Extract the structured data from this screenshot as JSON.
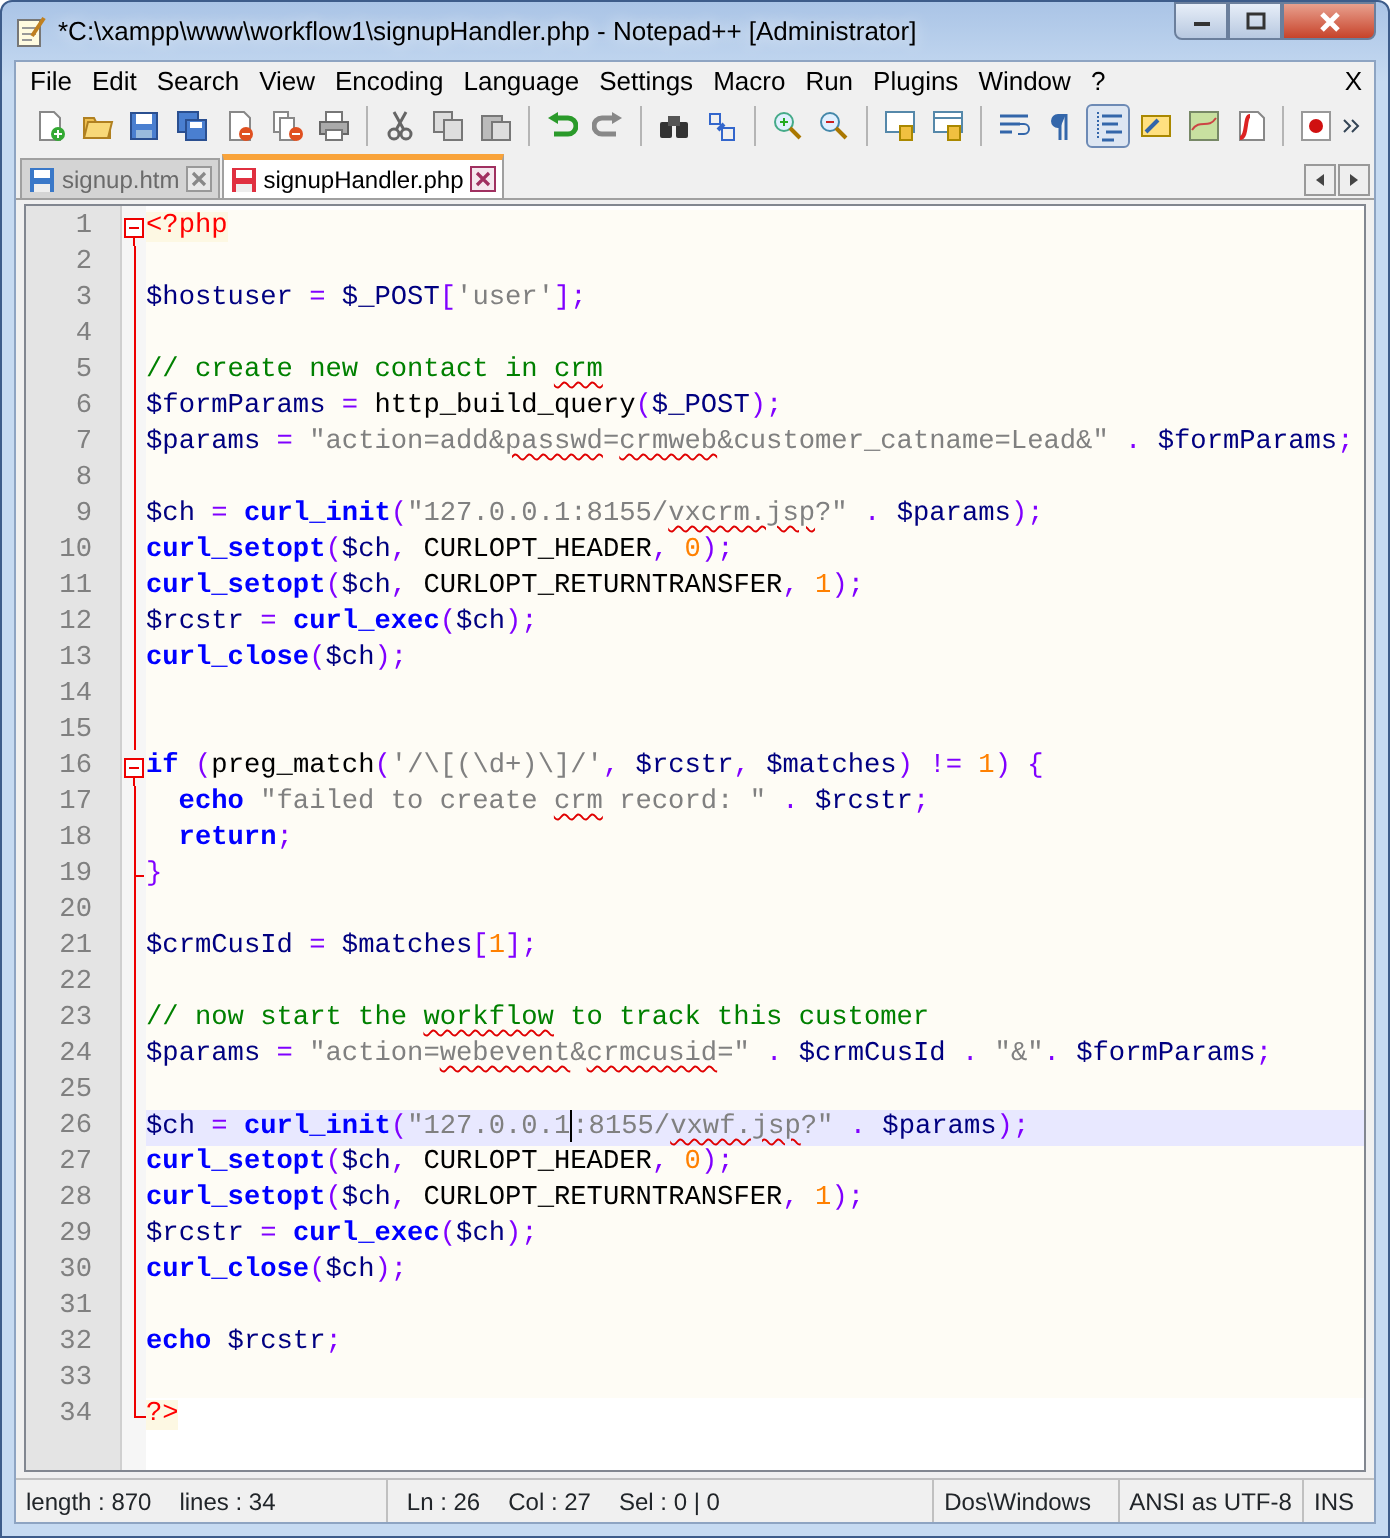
{
  "window": {
    "title": "*C:\\xampp\\www\\workflow1\\signupHandler.php - Notepad++ [Administrator]"
  },
  "menu": [
    "File",
    "Edit",
    "Search",
    "View",
    "Encoding",
    "Language",
    "Settings",
    "Macro",
    "Run",
    "Plugins",
    "Window",
    "?"
  ],
  "menu_close": "X",
  "toolbar": [
    {
      "kind": "new",
      "pressed": false
    },
    {
      "kind": "open",
      "pressed": false
    },
    {
      "kind": "save",
      "pressed": false
    },
    {
      "kind": "saveall",
      "pressed": false
    },
    {
      "kind": "close",
      "pressed": false
    },
    {
      "kind": "closeall",
      "pressed": false
    },
    {
      "kind": "print",
      "pressed": false
    },
    {
      "kind": "sep"
    },
    {
      "kind": "cut",
      "pressed": false
    },
    {
      "kind": "copy",
      "pressed": false
    },
    {
      "kind": "paste",
      "pressed": false
    },
    {
      "kind": "sep"
    },
    {
      "kind": "undo",
      "pressed": false
    },
    {
      "kind": "redo",
      "pressed": false
    },
    {
      "kind": "sep"
    },
    {
      "kind": "find",
      "pressed": false
    },
    {
      "kind": "replace",
      "pressed": false
    },
    {
      "kind": "sep"
    },
    {
      "kind": "zoomin",
      "pressed": false
    },
    {
      "kind": "zoomout",
      "pressed": false
    },
    {
      "kind": "sep"
    },
    {
      "kind": "syncv",
      "pressed": false
    },
    {
      "kind": "synch",
      "pressed": false
    },
    {
      "kind": "sep"
    },
    {
      "kind": "wrap",
      "pressed": false
    },
    {
      "kind": "pilcrow",
      "pressed": false
    },
    {
      "kind": "indent",
      "pressed": true
    },
    {
      "kind": "udl",
      "pressed": false
    },
    {
      "kind": "docmap",
      "pressed": false
    },
    {
      "kind": "funclist",
      "pressed": false
    },
    {
      "kind": "sep"
    },
    {
      "kind": "record",
      "pressed": false
    }
  ],
  "tabs": [
    {
      "label": "signup.htm",
      "selected": false,
      "modified": false
    },
    {
      "label": "signupHandler.php",
      "selected": true,
      "modified": true
    }
  ],
  "editor": {
    "lines": [
      {
        "n": "1",
        "kind": "open",
        "current": false,
        "indented": false,
        "tokens": [
          {
            "text": "<?php",
            "kind": "php"
          }
        ]
      },
      {
        "n": "2",
        "kind": "body",
        "current": false,
        "indented": false
      },
      {
        "n": "3",
        "kind": "body",
        "current": false,
        "indented": false,
        "tokens": [
          {
            "text": "$hostuser",
            "kind": "v"
          },
          {
            "text": " = ",
            "kind": "o"
          },
          {
            "text": "$_POST",
            "kind": "v"
          },
          {
            "text": "[",
            "kind": "o"
          },
          {
            "text": "'user'",
            "kind": "s"
          },
          {
            "text": "];",
            "kind": "o"
          }
        ]
      },
      {
        "n": "4",
        "kind": "body",
        "current": false,
        "indented": false
      },
      {
        "n": "5",
        "kind": "body",
        "current": false,
        "indented": false,
        "tokens": [
          {
            "text": "// create new contact in ",
            "kind": "c"
          },
          {
            "text": "crm",
            "kind": "cx"
          }
        ]
      },
      {
        "n": "6",
        "kind": "body",
        "current": false,
        "indented": false,
        "tokens": [
          {
            "text": "$formParams",
            "kind": "v"
          },
          {
            "text": " = ",
            "kind": "o"
          },
          {
            "text": "http_build_query",
            "kind": "p"
          },
          {
            "text": "(",
            "kind": "o"
          },
          {
            "text": "$_POST",
            "kind": "v"
          },
          {
            "text": ");",
            "kind": "o"
          }
        ]
      },
      {
        "n": "7",
        "kind": "body",
        "current": false,
        "indented": false,
        "tokens": [
          {
            "text": "$params",
            "kind": "v"
          },
          {
            "text": " = ",
            "kind": "o"
          },
          {
            "text": "\"action=add&",
            "kind": "s"
          },
          {
            "text": "passwd",
            "kind": "sx"
          },
          {
            "text": "=",
            "kind": "s"
          },
          {
            "text": "crmweb",
            "kind": "sx"
          },
          {
            "text": "&customer_catname=Lead&\"",
            "kind": "s"
          },
          {
            "text": " . ",
            "kind": "o"
          },
          {
            "text": "$formParams",
            "kind": "v"
          },
          {
            "text": ";",
            "kind": "o"
          }
        ]
      },
      {
        "n": "8",
        "kind": "body",
        "current": false,
        "indented": false
      },
      {
        "n": "9",
        "kind": "body",
        "current": false,
        "indented": false,
        "tokens": [
          {
            "text": "$ch",
            "kind": "v"
          },
          {
            "text": " = ",
            "kind": "o"
          },
          {
            "text": "curl_init",
            "kind": "f"
          },
          {
            "text": "(",
            "kind": "o"
          },
          {
            "text": "\"127.0.0.1:8155/",
            "kind": "s"
          },
          {
            "text": "vxcrm.jsp",
            "kind": "sx"
          },
          {
            "text": "?\"",
            "kind": "s"
          },
          {
            "text": " . ",
            "kind": "o"
          },
          {
            "text": "$params",
            "kind": "v"
          },
          {
            "text": ");",
            "kind": "o"
          }
        ]
      },
      {
        "n": "10",
        "kind": "body",
        "current": false,
        "indented": false,
        "tokens": [
          {
            "text": "curl_setopt",
            "kind": "f"
          },
          {
            "text": "(",
            "kind": "o"
          },
          {
            "text": "$ch",
            "kind": "v"
          },
          {
            "text": ", ",
            "kind": "o"
          },
          {
            "text": "CURLOPT_HEADER",
            "kind": "p"
          },
          {
            "text": ", ",
            "kind": "o"
          },
          {
            "text": "0",
            "kind": "n"
          },
          {
            "text": ");",
            "kind": "o"
          }
        ]
      },
      {
        "n": "11",
        "kind": "body",
        "current": false,
        "indented": false,
        "tokens": [
          {
            "text": "curl_setopt",
            "kind": "f"
          },
          {
            "text": "(",
            "kind": "o"
          },
          {
            "text": "$ch",
            "kind": "v"
          },
          {
            "text": ", ",
            "kind": "o"
          },
          {
            "text": "CURLOPT_RETURNTRANSFER",
            "kind": "p"
          },
          {
            "text": ", ",
            "kind": "o"
          },
          {
            "text": "1",
            "kind": "n"
          },
          {
            "text": ");",
            "kind": "o"
          }
        ]
      },
      {
        "n": "12",
        "kind": "body",
        "current": false,
        "indented": false,
        "tokens": [
          {
            "text": "$rcstr",
            "kind": "v"
          },
          {
            "text": " = ",
            "kind": "o"
          },
          {
            "text": "curl_exec",
            "kind": "f"
          },
          {
            "text": "(",
            "kind": "o"
          },
          {
            "text": "$ch",
            "kind": "v"
          },
          {
            "text": ");",
            "kind": "o"
          }
        ]
      },
      {
        "n": "13",
        "kind": "body",
        "current": false,
        "indented": false,
        "tokens": [
          {
            "text": "curl_close",
            "kind": "f"
          },
          {
            "text": "(",
            "kind": "o"
          },
          {
            "text": "$ch",
            "kind": "v"
          },
          {
            "text": ");",
            "kind": "o"
          }
        ]
      },
      {
        "n": "14",
        "kind": "body",
        "current": false,
        "indented": false
      },
      {
        "n": "15",
        "kind": "body",
        "current": false,
        "indented": false
      },
      {
        "n": "16",
        "kind": "open",
        "current": false,
        "indented": false,
        "tokens": [
          {
            "text": "if",
            "kind": "kw"
          },
          {
            "text": " (",
            "kind": "o"
          },
          {
            "text": "preg_match",
            "kind": "p"
          },
          {
            "text": "(",
            "kind": "o"
          },
          {
            "text": "'/\\[(\\d+)\\]/'",
            "kind": "s"
          },
          {
            "text": ", ",
            "kind": "o"
          },
          {
            "text": "$rcstr",
            "kind": "v"
          },
          {
            "text": ", ",
            "kind": "o"
          },
          {
            "text": "$matches",
            "kind": "v"
          },
          {
            "text": ") != ",
            "kind": "o"
          },
          {
            "text": "1",
            "kind": "n"
          },
          {
            "text": ") {",
            "kind": "o"
          }
        ]
      },
      {
        "n": "17",
        "kind": "body",
        "current": false,
        "indented": true,
        "tokens": [
          {
            "text": "echo",
            "kind": "kw"
          },
          {
            "text": " \"failed to create ",
            "kind": "s"
          },
          {
            "text": "crm",
            "kind": "sx"
          },
          {
            "text": " record: \"",
            "kind": "s"
          },
          {
            "text": " . ",
            "kind": "o"
          },
          {
            "text": "$rcstr",
            "kind": "v"
          },
          {
            "text": ";",
            "kind": "o"
          }
        ]
      },
      {
        "n": "18",
        "kind": "body",
        "current": false,
        "indented": true,
        "tokens": [
          {
            "text": "return",
            "kind": "kw"
          },
          {
            "text": ";",
            "kind": "o"
          }
        ]
      },
      {
        "n": "19",
        "kind": "end",
        "current": false,
        "indented": false,
        "tokens": [
          {
            "text": "}",
            "kind": "o"
          }
        ]
      },
      {
        "n": "20",
        "kind": "body",
        "current": false,
        "indented": false
      },
      {
        "n": "21",
        "kind": "body",
        "current": false,
        "indented": false,
        "tokens": [
          {
            "text": "$crmCusId",
            "kind": "v"
          },
          {
            "text": " = ",
            "kind": "o"
          },
          {
            "text": "$matches",
            "kind": "v"
          },
          {
            "text": "[",
            "kind": "o"
          },
          {
            "text": "1",
            "kind": "n"
          },
          {
            "text": "];",
            "kind": "o"
          }
        ]
      },
      {
        "n": "22",
        "kind": "body",
        "current": false,
        "indented": false
      },
      {
        "n": "23",
        "kind": "body",
        "current": false,
        "indented": false,
        "tokens": [
          {
            "text": "// now start the ",
            "kind": "c"
          },
          {
            "text": "workflow",
            "kind": "cx"
          },
          {
            "text": " to track this customer",
            "kind": "c"
          }
        ]
      },
      {
        "n": "24",
        "kind": "body",
        "current": false,
        "indented": false,
        "tokens": [
          {
            "text": "$params",
            "kind": "v"
          },
          {
            "text": " = ",
            "kind": "o"
          },
          {
            "text": "\"action=",
            "kind": "s"
          },
          {
            "text": "webevent",
            "kind": "sx"
          },
          {
            "text": "&",
            "kind": "s"
          },
          {
            "text": "crmcusid",
            "kind": "sx"
          },
          {
            "text": "=\"",
            "kind": "s"
          },
          {
            "text": " . ",
            "kind": "o"
          },
          {
            "text": "$crmCusId",
            "kind": "v"
          },
          {
            "text": " . ",
            "kind": "o"
          },
          {
            "text": "\"&\"",
            "kind": "s"
          },
          {
            "text": ". ",
            "kind": "o"
          },
          {
            "text": "$formParams",
            "kind": "v"
          },
          {
            "text": ";",
            "kind": "o"
          }
        ]
      },
      {
        "n": "25",
        "kind": "body",
        "current": false,
        "indented": false
      },
      {
        "n": "26",
        "kind": "body",
        "current": true,
        "indented": false,
        "tokens": [
          {
            "text": "$ch",
            "kind": "v"
          },
          {
            "text": " = ",
            "kind": "o"
          },
          {
            "text": "curl_init",
            "kind": "f"
          },
          {
            "text": "(",
            "kind": "o"
          },
          {
            "text": "\"127.0.0.1",
            "kind": "s",
            "caret_after": true
          },
          {
            "text": ":8155/",
            "kind": "s"
          },
          {
            "text": "vxwf.jsp",
            "kind": "sx"
          },
          {
            "text": "?\"",
            "kind": "s"
          },
          {
            "text": " . ",
            "kind": "o"
          },
          {
            "text": "$params",
            "kind": "v"
          },
          {
            "text": ");",
            "kind": "o"
          }
        ]
      },
      {
        "n": "27",
        "kind": "body",
        "current": false,
        "indented": false,
        "tokens": [
          {
            "text": "curl_setopt",
            "kind": "f"
          },
          {
            "text": "(",
            "kind": "o"
          },
          {
            "text": "$ch",
            "kind": "v"
          },
          {
            "text": ", ",
            "kind": "o"
          },
          {
            "text": "CURLOPT_HEADER",
            "kind": "p"
          },
          {
            "text": ", ",
            "kind": "o"
          },
          {
            "text": "0",
            "kind": "n"
          },
          {
            "text": ");",
            "kind": "o"
          }
        ]
      },
      {
        "n": "28",
        "kind": "body",
        "current": false,
        "indented": false,
        "tokens": [
          {
            "text": "curl_setopt",
            "kind": "f"
          },
          {
            "text": "(",
            "kind": "o"
          },
          {
            "text": "$ch",
            "kind": "v"
          },
          {
            "text": ", ",
            "kind": "o"
          },
          {
            "text": "CURLOPT_RETURNTRANSFER",
            "kind": "p"
          },
          {
            "text": ", ",
            "kind": "o"
          },
          {
            "text": "1",
            "kind": "n"
          },
          {
            "text": ");",
            "kind": "o"
          }
        ]
      },
      {
        "n": "29",
        "kind": "body",
        "current": false,
        "indented": false,
        "tokens": [
          {
            "text": "$rcstr",
            "kind": "v"
          },
          {
            "text": " = ",
            "kind": "o"
          },
          {
            "text": "curl_exec",
            "kind": "f"
          },
          {
            "text": "(",
            "kind": "o"
          },
          {
            "text": "$ch",
            "kind": "v"
          },
          {
            "text": ");",
            "kind": "o"
          }
        ]
      },
      {
        "n": "30",
        "kind": "body",
        "current": false,
        "indented": false,
        "tokens": [
          {
            "text": "curl_close",
            "kind": "f"
          },
          {
            "text": "(",
            "kind": "o"
          },
          {
            "text": "$ch",
            "kind": "v"
          },
          {
            "text": ");",
            "kind": "o"
          }
        ]
      },
      {
        "n": "31",
        "kind": "body",
        "current": false,
        "indented": false
      },
      {
        "n": "32",
        "kind": "body",
        "current": false,
        "indented": false,
        "tokens": [
          {
            "text": "echo",
            "kind": "kw"
          },
          {
            "text": " $rcstr",
            "kind": "v"
          },
          {
            "text": ";",
            "kind": "o"
          }
        ]
      },
      {
        "n": "33",
        "kind": "body",
        "current": false,
        "indented": false
      },
      {
        "n": "34",
        "kind": "close",
        "current": false,
        "indented": false,
        "tokens": [
          {
            "text": "?>",
            "kind": "php"
          }
        ]
      }
    ]
  },
  "status_bar": [
    {
      "texts": [
        "length : 870",
        "lines : 34"
      ]
    },
    {
      "texts": [
        "Ln : 26",
        "Col : 27",
        "Sel : 0 | 0"
      ]
    },
    {
      "texts": [
        "Dos\\Windows"
      ]
    },
    {
      "texts": [
        "ANSI as UTF-8"
      ]
    },
    {
      "texts": [
        "INS"
      ]
    }
  ]
}
